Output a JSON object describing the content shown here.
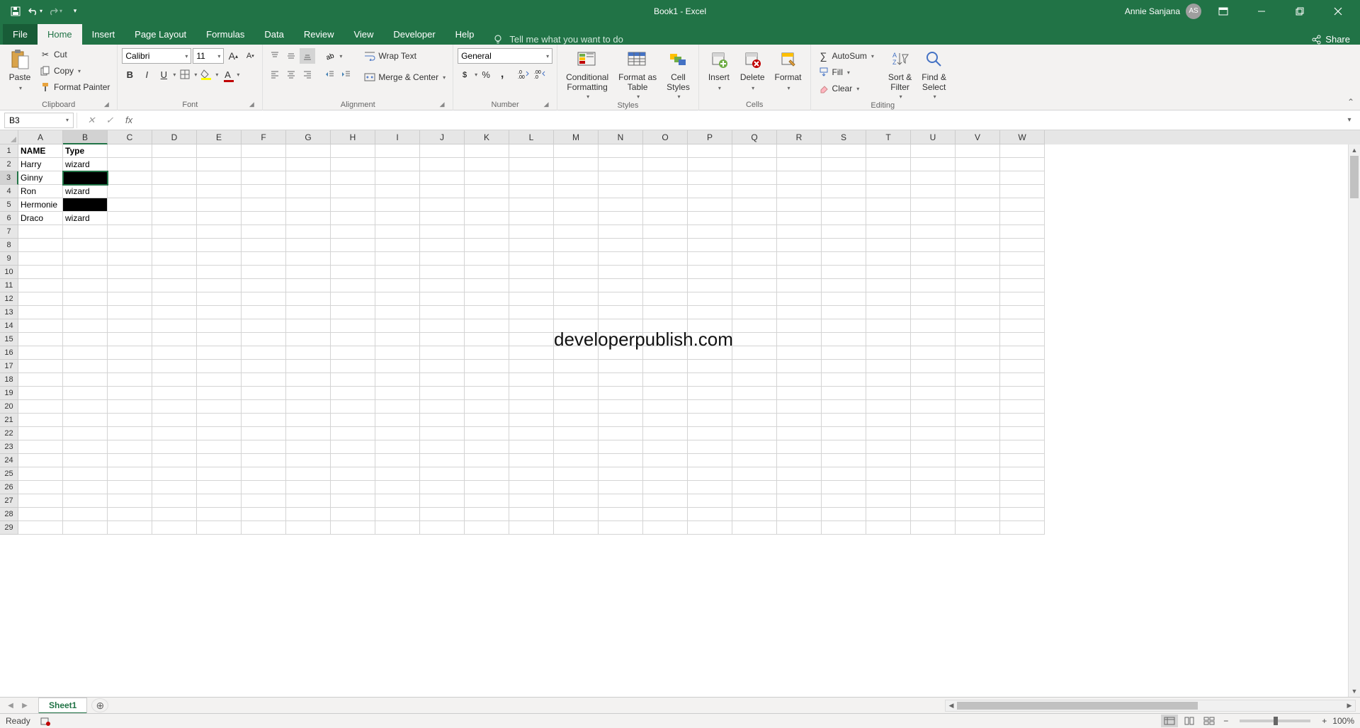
{
  "title": "Book1  -  Excel",
  "user": {
    "name": "Annie Sanjana",
    "initials": "AS"
  },
  "tabs": [
    "File",
    "Home",
    "Insert",
    "Page Layout",
    "Formulas",
    "Data",
    "Review",
    "View",
    "Developer",
    "Help"
  ],
  "active_tab": "Home",
  "tell_me": "Tell me what you want to do",
  "share": "Share",
  "ribbon": {
    "clipboard": {
      "label": "Clipboard",
      "paste": "Paste",
      "cut": "Cut",
      "copy": "Copy",
      "format_painter": "Format Painter"
    },
    "font": {
      "label": "Font",
      "name": "Calibri",
      "size": "11"
    },
    "alignment": {
      "label": "Alignment",
      "wrap": "Wrap Text",
      "merge": "Merge & Center"
    },
    "number": {
      "label": "Number",
      "format": "General"
    },
    "styles": {
      "label": "Styles",
      "cond": "Conditional\nFormatting",
      "table": "Format as\nTable",
      "cell": "Cell\nStyles"
    },
    "cells": {
      "label": "Cells",
      "insert": "Insert",
      "delete": "Delete",
      "format": "Format"
    },
    "editing": {
      "label": "Editing",
      "autosum": "AutoSum",
      "fill": "Fill",
      "clear": "Clear",
      "sort": "Sort &\nFilter",
      "find": "Find &\nSelect"
    }
  },
  "name_box": "B3",
  "formula": "",
  "columns": [
    "A",
    "B",
    "C",
    "D",
    "E",
    "F",
    "G",
    "H",
    "I",
    "J",
    "K",
    "L",
    "M",
    "N",
    "O",
    "P",
    "Q",
    "R",
    "S",
    "T",
    "U",
    "V",
    "W"
  ],
  "active_col": "B",
  "active_row": 3,
  "rows": 29,
  "cells": {
    "A1": {
      "v": "NAME",
      "bold": true
    },
    "B1": {
      "v": "Type",
      "bold": true
    },
    "A2": {
      "v": "Harry"
    },
    "B2": {
      "v": "wizard"
    },
    "A3": {
      "v": "Ginny"
    },
    "B3": {
      "v": "",
      "fill": "black"
    },
    "A4": {
      "v": "Ron"
    },
    "B4": {
      "v": "wizard"
    },
    "A5": {
      "v": "Hermonie"
    },
    "B5": {
      "v": "",
      "fill": "black"
    },
    "A6": {
      "v": "Draco"
    },
    "B6": {
      "v": "wizard"
    }
  },
  "watermark": "developerpublish.com",
  "sheet": "Sheet1",
  "status": "Ready",
  "zoom": "100%"
}
